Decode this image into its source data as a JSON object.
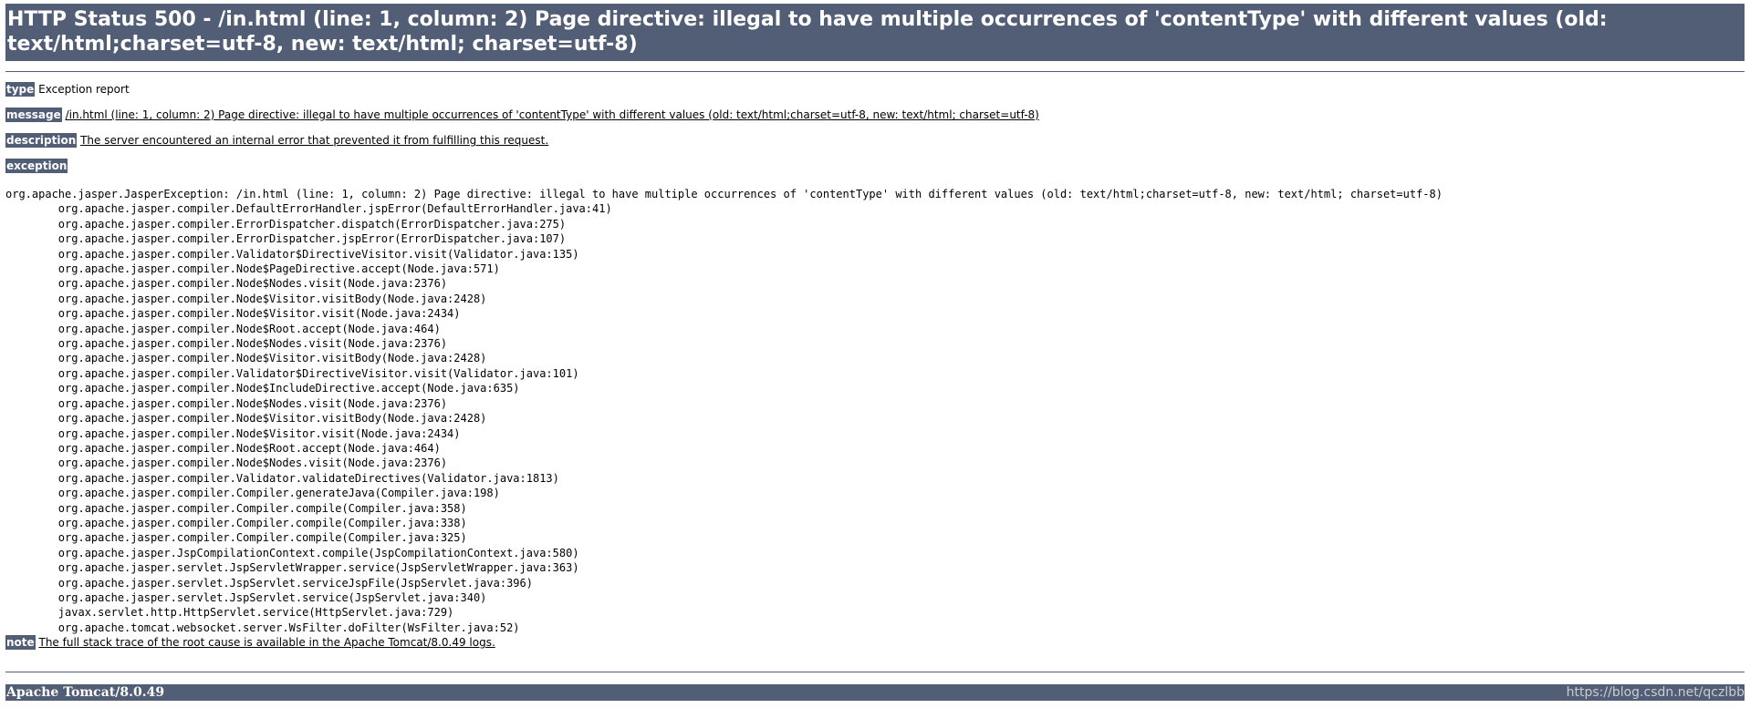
{
  "title": "HTTP Status 500 - /in.html (line: 1, column: 2) Page directive: illegal to have multiple occurrences of 'contentType' with different values (old: text/html;charset=utf-8, new: text/html; charset=utf-8)",
  "type": {
    "label": "type",
    "value": "Exception report"
  },
  "message": {
    "label": "message",
    "value": "/in.html (line: 1, column: 2) Page directive: illegal to have multiple occurrences of 'contentType' with different values (old: text/html;charset=utf-8, new: text/html; charset=utf-8)"
  },
  "description": {
    "label": "description",
    "value": "The server encountered an internal error that prevented it from fulfilling this request."
  },
  "exception": {
    "label": "exception"
  },
  "stack_trace": "org.apache.jasper.JasperException: /in.html (line: 1, column: 2) Page directive: illegal to have multiple occurrences of 'contentType' with different values (old: text/html;charset=utf-8, new: text/html; charset=utf-8)\n\torg.apache.jasper.compiler.DefaultErrorHandler.jspError(DefaultErrorHandler.java:41)\n\torg.apache.jasper.compiler.ErrorDispatcher.dispatch(ErrorDispatcher.java:275)\n\torg.apache.jasper.compiler.ErrorDispatcher.jspError(ErrorDispatcher.java:107)\n\torg.apache.jasper.compiler.Validator$DirectiveVisitor.visit(Validator.java:135)\n\torg.apache.jasper.compiler.Node$PageDirective.accept(Node.java:571)\n\torg.apache.jasper.compiler.Node$Nodes.visit(Node.java:2376)\n\torg.apache.jasper.compiler.Node$Visitor.visitBody(Node.java:2428)\n\torg.apache.jasper.compiler.Node$Visitor.visit(Node.java:2434)\n\torg.apache.jasper.compiler.Node$Root.accept(Node.java:464)\n\torg.apache.jasper.compiler.Node$Nodes.visit(Node.java:2376)\n\torg.apache.jasper.compiler.Node$Visitor.visitBody(Node.java:2428)\n\torg.apache.jasper.compiler.Validator$DirectiveVisitor.visit(Validator.java:101)\n\torg.apache.jasper.compiler.Node$IncludeDirective.accept(Node.java:635)\n\torg.apache.jasper.compiler.Node$Nodes.visit(Node.java:2376)\n\torg.apache.jasper.compiler.Node$Visitor.visitBody(Node.java:2428)\n\torg.apache.jasper.compiler.Node$Visitor.visit(Node.java:2434)\n\torg.apache.jasper.compiler.Node$Root.accept(Node.java:464)\n\torg.apache.jasper.compiler.Node$Nodes.visit(Node.java:2376)\n\torg.apache.jasper.compiler.Validator.validateDirectives(Validator.java:1813)\n\torg.apache.jasper.compiler.Compiler.generateJava(Compiler.java:198)\n\torg.apache.jasper.compiler.Compiler.compile(Compiler.java:358)\n\torg.apache.jasper.compiler.Compiler.compile(Compiler.java:338)\n\torg.apache.jasper.compiler.Compiler.compile(Compiler.java:325)\n\torg.apache.jasper.JspCompilationContext.compile(JspCompilationContext.java:580)\n\torg.apache.jasper.servlet.JspServletWrapper.service(JspServletWrapper.java:363)\n\torg.apache.jasper.servlet.JspServlet.serviceJspFile(JspServlet.java:396)\n\torg.apache.jasper.servlet.JspServlet.service(JspServlet.java:340)\n\tjavax.servlet.http.HttpServlet.service(HttpServlet.java:729)\n\torg.apache.tomcat.websocket.server.WsFilter.doFilter(WsFilter.java:52)",
  "note": {
    "label": "note",
    "value": "The full stack trace of the root cause is available in the Apache Tomcat/8.0.49 logs."
  },
  "footer": {
    "server": "Apache Tomcat/8.0.49",
    "watermark": "https://blog.csdn.net/qczlbb"
  },
  "colors": {
    "header_bg": "#525d76",
    "header_text": "#ffffff"
  }
}
